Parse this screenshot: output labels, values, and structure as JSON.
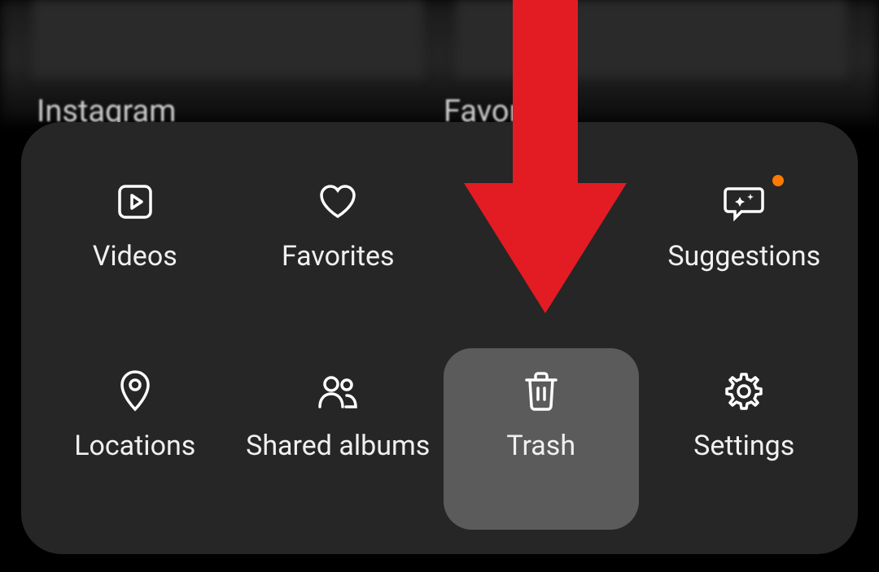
{
  "background": {
    "album1_label": "Instagram",
    "album2_label": "Favorites"
  },
  "sheet": {
    "items": [
      {
        "icon": "videos",
        "label": "Videos",
        "badge": false,
        "highlighted": false
      },
      {
        "icon": "favorites",
        "label": "Favorites",
        "badge": false,
        "highlighted": false
      },
      {
        "icon": "hidden",
        "label": "",
        "badge": false,
        "highlighted": false
      },
      {
        "icon": "suggestions",
        "label": "Suggestions",
        "badge": true,
        "highlighted": false
      },
      {
        "icon": "locations",
        "label": "Locations",
        "badge": false,
        "highlighted": false
      },
      {
        "icon": "shared-albums",
        "label": "Shared albums",
        "badge": false,
        "highlighted": false
      },
      {
        "icon": "trash",
        "label": "Trash",
        "badge": false,
        "highlighted": true
      },
      {
        "icon": "settings",
        "label": "Settings",
        "badge": false,
        "highlighted": false
      }
    ]
  },
  "annotation": {
    "arrow_color": "#e31b23"
  }
}
